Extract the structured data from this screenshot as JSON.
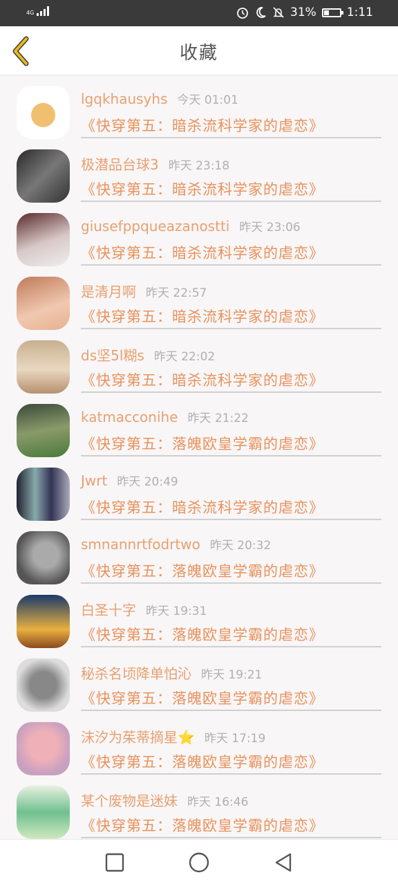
{
  "status_bar": {
    "network": "4G",
    "battery_percent": "31%",
    "battery_level": 0.31,
    "time": "1:11",
    "icons": [
      "alarm-icon",
      "moon-icon",
      "mute-icon",
      "battery-icon"
    ]
  },
  "header": {
    "title": "收藏",
    "back_icon": "chevron-left-icon",
    "accent_color": "#e8b820"
  },
  "colors": {
    "username": "#e8a070",
    "book": "#e8925c",
    "time": "#b0b0b0"
  },
  "items": [
    {
      "username": "lgqkhausyhs",
      "time": "今天 01:01",
      "book": "《快穿第五：暗杀流科学家的虐恋》"
    },
    {
      "username": "极潜品台球3",
      "time": "昨天 23:18",
      "book": "《快穿第五：暗杀流科学家的虐恋》"
    },
    {
      "username": "giusefppqueazanostti",
      "time": "昨天 23:06",
      "book": "《快穿第五：暗杀流科学家的虐恋》"
    },
    {
      "username": "是清月啊",
      "time": "昨天 22:57",
      "book": "《快穿第五：暗杀流科学家的虐恋》"
    },
    {
      "username": "ds坚5l糊s",
      "time": "昨天 22:02",
      "book": "《快穿第五：暗杀流科学家的虐恋》"
    },
    {
      "username": "katmacconihe",
      "time": "昨天 21:22",
      "book": "《快穿第五：落魄欧皇学霸的虐恋》"
    },
    {
      "username": "Jwrt",
      "time": "昨天 20:49",
      "book": "《快穿第五：暗杀流科学家的虐恋》"
    },
    {
      "username": "smnannrtfodrtwo",
      "time": "昨天 20:32",
      "book": "《快穿第五：落魄欧皇学霸的虐恋》"
    },
    {
      "username": "白圣十字",
      "time": "昨天 19:31",
      "book": "《快穿第五：落魄欧皇学霸的虐恋》"
    },
    {
      "username": "秘杀名顷降单怕沁",
      "time": "昨天 19:21",
      "book": "《快穿第五：落魄欧皇学霸的虐恋》"
    },
    {
      "username": "沫汐为茱蒂摘星⭐",
      "time": "昨天 17:19",
      "book": "《快穿第五：落魄欧皇学霸的虐恋》"
    },
    {
      "username": "某个废物是迷妹",
      "time": "昨天 16:46",
      "book": "《快穿第五：落魄欧皇学霸的虐恋》"
    }
  ],
  "nav_bar": {
    "icons": [
      "square-recent-icon",
      "circle-home-icon",
      "triangle-back-icon"
    ]
  }
}
